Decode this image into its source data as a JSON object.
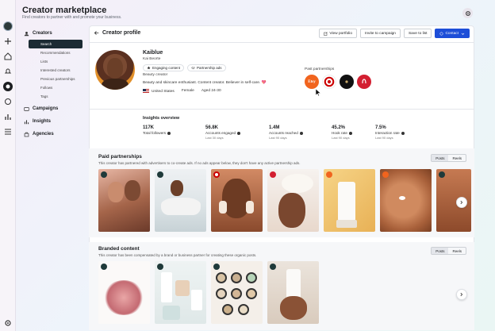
{
  "app": {
    "title": "Creator marketplace",
    "subtitle": "Find creators to partner with and promote your business."
  },
  "nav": {
    "creators_label": "Creators",
    "creators_items": [
      "Search",
      "Recommendations",
      "Lists",
      "Interested creators",
      "Previous partnerships",
      "Follows",
      "Tags"
    ],
    "campaigns_label": "Campaigns",
    "insights_label": "Insights",
    "agencies_label": "Agencies"
  },
  "profile_header": {
    "back_label": "Creator profile",
    "view_portfolio": "View portfolio",
    "invite": "Invite to campaign",
    "save": "Save to list",
    "contact": "Contact"
  },
  "creator": {
    "name": "Kaiblue",
    "handle": "Kai Beorte",
    "chips": [
      "Engaging content",
      "Partnership ads"
    ],
    "category": "Beauty creator",
    "bio": "Beauty and skincare enthusiast. Content creator. Believer in self-care. 💖",
    "country": "United States",
    "gender": "Female",
    "age": "Aged 24-30",
    "past_partnerships_label": "Past partnerships",
    "brands": [
      {
        "name": "Etsy",
        "color": "#f1641e"
      },
      {
        "name": "Target",
        "color": "#cc0000"
      },
      {
        "name": "",
        "color": "#111111"
      },
      {
        "name": "lululemon",
        "color": "#d31f31"
      }
    ]
  },
  "insights": {
    "title": "Insights overview",
    "stats": [
      {
        "value": "117K",
        "label": "Total followers",
        "period": ""
      },
      {
        "value": "56.8K",
        "label": "Accounts engaged",
        "period": "Last 30 days"
      },
      {
        "value": "1.4M",
        "label": "Accounts reached",
        "period": "Last 90 days"
      },
      {
        "value": "45.2%",
        "label": "Hook rate",
        "period": "Last 90 days"
      },
      {
        "value": "7.5%",
        "label": "Interaction rate",
        "period": "Last 90 days"
      }
    ]
  },
  "paid": {
    "title": "Paid partnerships",
    "subtitle": "This creator has partnered with advertisers to co-create ads. If no ads appear below, they don't have any active partnership ads.",
    "toggle": [
      "Posts",
      "Reels"
    ]
  },
  "branded": {
    "title": "Branded content",
    "subtitle": "This creator has been compensated by a brand or business partner for creating these organic posts.",
    "toggle": [
      "Posts",
      "Reels"
    ]
  }
}
